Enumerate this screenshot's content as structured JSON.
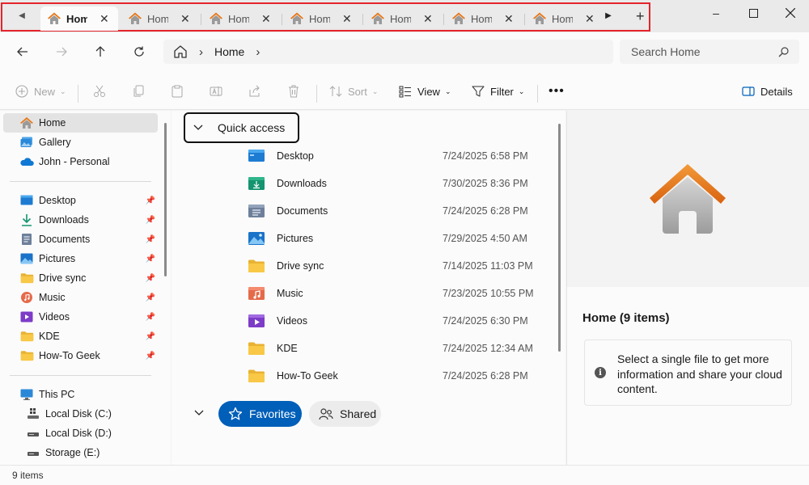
{
  "tabs": [
    {
      "title": "Home",
      "active": true
    },
    {
      "title": "Home",
      "active": false
    },
    {
      "title": "Home",
      "active": false
    },
    {
      "title": "Home",
      "active": false
    },
    {
      "title": "Home",
      "active": false
    },
    {
      "title": "Home",
      "active": false
    },
    {
      "title": "Home",
      "active": false
    }
  ],
  "address": {
    "crumb": "Home"
  },
  "search": {
    "placeholder": "Search Home"
  },
  "commands": {
    "new": "New",
    "sort": "Sort",
    "view": "View",
    "filter": "Filter",
    "details": "Details"
  },
  "sidebar": {
    "top": [
      {
        "label": "Home",
        "icon": "home-icon"
      },
      {
        "label": "Gallery",
        "icon": "gallery-icon"
      },
      {
        "label": "John - Personal",
        "icon": "onedrive-cloud-icon"
      }
    ],
    "pinned": [
      {
        "label": "Desktop",
        "icon": "desktop-folder-icon"
      },
      {
        "label": "Downloads",
        "icon": "download-arrow-icon"
      },
      {
        "label": "Documents",
        "icon": "documents-icon"
      },
      {
        "label": "Pictures",
        "icon": "pictures-icon"
      },
      {
        "label": "Drive sync",
        "icon": "folder-icon"
      },
      {
        "label": "Music",
        "icon": "music-icon"
      },
      {
        "label": "Videos",
        "icon": "videos-icon"
      },
      {
        "label": "KDE",
        "icon": "folder-icon"
      },
      {
        "label": "How-To Geek",
        "icon": "folder-icon"
      }
    ],
    "this_pc": {
      "label": "This PC",
      "icon": "pc-icon"
    },
    "drives": [
      {
        "label": "Local Disk (C:)",
        "icon": "windows-drive-icon"
      },
      {
        "label": "Local Disk (D:)",
        "icon": "drive-icon"
      },
      {
        "label": "Storage (E:)",
        "icon": "drive-icon"
      }
    ]
  },
  "quick_access": {
    "header": "Quick access",
    "items": [
      {
        "name": "Desktop",
        "date": "7/24/2025 6:58 PM",
        "icon": "desktop-folder-icon"
      },
      {
        "name": "Downloads",
        "date": "7/30/2025 8:36 PM",
        "icon": "downloads-folder-icon"
      },
      {
        "name": "Documents",
        "date": "7/24/2025 6:28 PM",
        "icon": "documents-folder-icon"
      },
      {
        "name": "Pictures",
        "date": "7/29/2025 4:50 AM",
        "icon": "pictures-folder-icon"
      },
      {
        "name": "Drive sync",
        "date": "7/14/2025 11:03 PM",
        "icon": "folder-icon"
      },
      {
        "name": "Music",
        "date": "7/23/2025 10:55 PM",
        "icon": "music-folder-icon"
      },
      {
        "name": "Videos",
        "date": "7/24/2025 6:30 PM",
        "icon": "videos-folder-icon"
      },
      {
        "name": "KDE",
        "date": "7/24/2025 12:34 AM",
        "icon": "folder-icon"
      },
      {
        "name": "How-To Geek",
        "date": "7/24/2025 6:28 PM",
        "icon": "folder-icon"
      }
    ]
  },
  "sections": {
    "favorites": "Favorites",
    "shared": "Shared"
  },
  "details": {
    "title": "Home (9 items)",
    "info": "Select a single file to get more information and share your cloud content."
  },
  "status": {
    "count": "9 items"
  },
  "colors": {
    "accent": "#005fb8",
    "highlight_border": "#e5242b",
    "folder": "#f8c846",
    "home_roof": "#e8781a"
  }
}
